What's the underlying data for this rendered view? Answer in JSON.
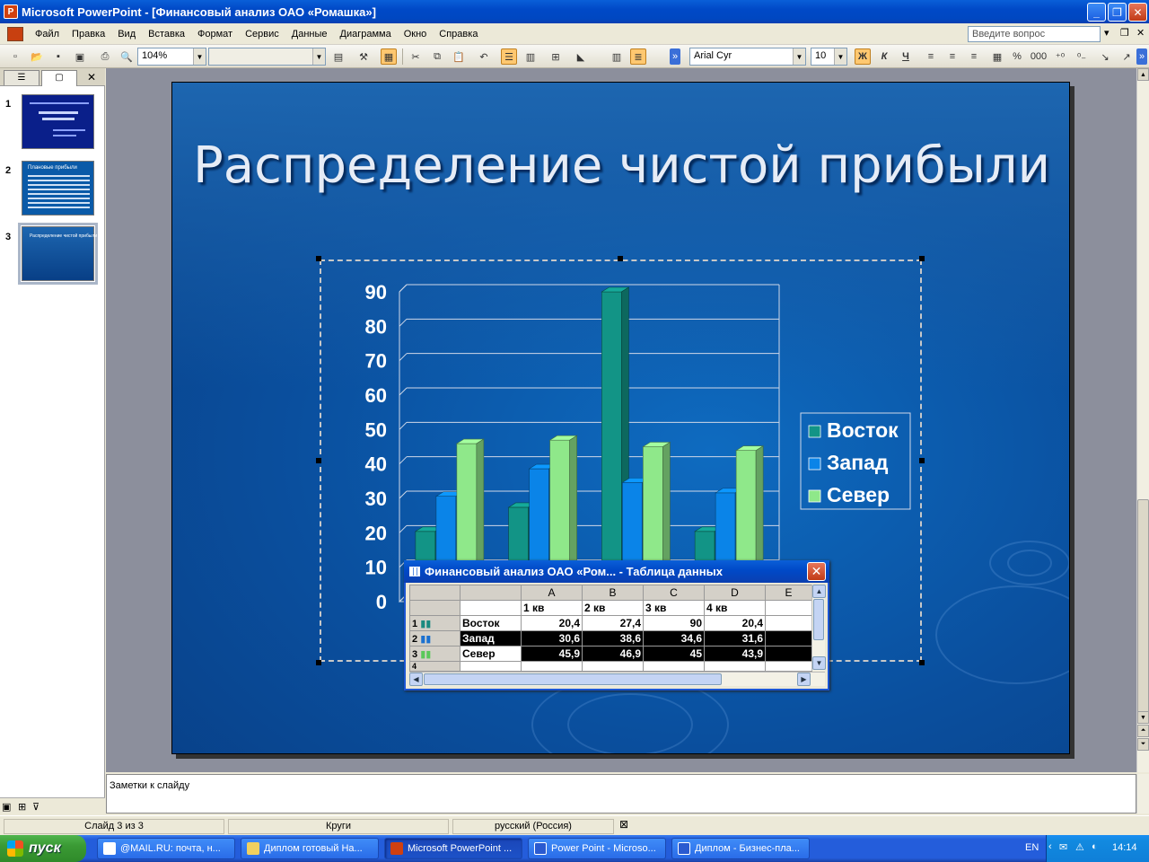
{
  "window": {
    "title": "Microsoft PowerPoint - [Финансовый анализ ОАО «Ромашка»]"
  },
  "menu": {
    "items": [
      "Файл",
      "Правка",
      "Вид",
      "Вставка",
      "Формат",
      "Сервис",
      "Данные",
      "Диаграмма",
      "Окно",
      "Справка"
    ],
    "help_placeholder": "Введите вопрос"
  },
  "toolbar": {
    "zoom": "104%",
    "font_name": "Arial Cyr",
    "font_size": "10",
    "bold_label": "Ж",
    "italic_label": "К",
    "underline_label": "Ч",
    "percent_label": "%",
    "thousands_label": "000"
  },
  "slides_pane": {
    "slides": [
      {
        "number": "1"
      },
      {
        "number": "2",
        "title": "Плановые прибыли"
      },
      {
        "number": "3",
        "title": "Распределение чистой прибыли"
      }
    ],
    "selected_index": 2
  },
  "slide": {
    "title": "Распределение чистой прибыли",
    "background": "#0a5aa8"
  },
  "chart_data": {
    "type": "bar",
    "categories": [
      "1 кв",
      "2 кв",
      "3 кв",
      "4 кв"
    ],
    "series": [
      {
        "name": "Восток",
        "values": [
          20.4,
          27.4,
          90,
          20.4
        ],
        "color": "#129486"
      },
      {
        "name": "Запад",
        "values": [
          30.6,
          38.6,
          34.6,
          31.6
        ],
        "color": "#0a84e8"
      },
      {
        "name": "Север",
        "values": [
          45.9,
          46.9,
          45,
          43.9
        ],
        "color": "#8fe88a"
      }
    ],
    "yticks": [
      "0",
      "10",
      "20",
      "30",
      "40",
      "50",
      "60",
      "70",
      "80",
      "90"
    ],
    "ylim": [
      0,
      90
    ],
    "grid": true,
    "legend": "right"
  },
  "datasheet": {
    "title": "Финансовый анализ ОАО «Ром... - Таблица данных",
    "columns": [
      "A",
      "B",
      "C",
      "D",
      "E"
    ],
    "header_row": [
      "1 кв",
      "2 кв",
      "3 кв",
      "4 кв"
    ],
    "rows": [
      {
        "num": "1",
        "label": "Восток",
        "values": [
          "20,4",
          "27,4",
          "90",
          "20,4"
        ]
      },
      {
        "num": "2",
        "label": "Запад",
        "values": [
          "30,6",
          "38,6",
          "34,6",
          "31,6"
        ]
      },
      {
        "num": "3",
        "label": "Север",
        "values": [
          "45,9",
          "46,9",
          "45",
          "43,9"
        ]
      }
    ],
    "extra_row": "4"
  },
  "notes": {
    "placeholder": "Заметки к слайду"
  },
  "status": {
    "slide_info": "Слайд 3 из 3",
    "design": "Круги",
    "language": "русский (Россия)"
  },
  "taskbar": {
    "start_label": "пуск",
    "tasks": [
      "@MAIL.RU: почта, н...",
      "Диплом готовый На...",
      "Microsoft PowerPoint ...",
      "Power Point - Microso...",
      "Диплом - Бизнес-пла..."
    ],
    "active_task": 2,
    "lang": "EN",
    "time": "14:14"
  }
}
